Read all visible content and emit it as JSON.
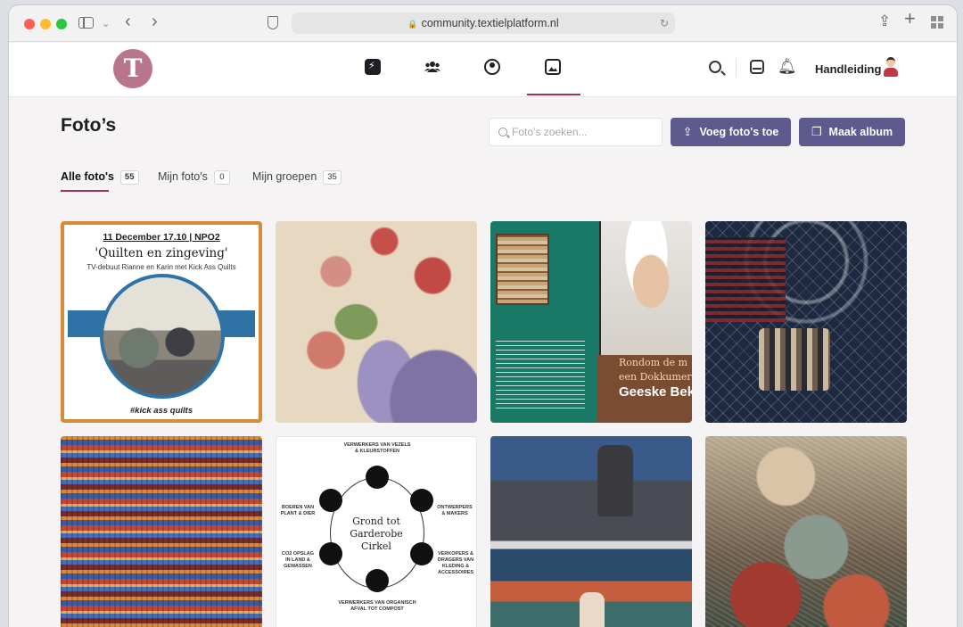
{
  "browser": {
    "url": "community.textielplatform.nl"
  },
  "header": {
    "logo_letter": "T",
    "nav_items": [
      {
        "icon": "activity-icon"
      },
      {
        "icon": "groups-icon"
      },
      {
        "icon": "profile-icon"
      },
      {
        "icon": "photos-icon",
        "active": true
      }
    ],
    "handleiding_label": "Handleiding"
  },
  "main": {
    "title": "Foto’s",
    "search_placeholder": "Foto’s zoeken...",
    "upload_button": "Voeg foto's toe",
    "album_button": "Maak album",
    "tabs": [
      {
        "label": "Alle foto's",
        "count": "55",
        "active": true
      },
      {
        "label": "Mijn foto's",
        "count": "0"
      },
      {
        "label": "Mijn groepen",
        "count": "35"
      }
    ]
  },
  "photos": {
    "quilt_poster": {
      "line1": "11 December 17.10 | NPO2",
      "line2": "'Quilten en zingeving'",
      "line3": "TV-debuut Rianne en Karin met Kick Ass Quilts",
      "hashtag": "#kick ass quilts"
    },
    "book_cover": {
      "line1": "Rondom de m",
      "line2": "een Dokkumer",
      "line3": "Geeske Bek"
    },
    "circle_diagram": {
      "center_line1": "Grond tot",
      "center_line2": "Garderobe",
      "center_line3": "Cirkel",
      "labels": [
        "VERWERKERS VAN VEZELS & KLEURSTOFFEN",
        "ONTWERPERS & MAKERS",
        "VERKOPERS & DRAGERS VAN KLEDING & ACCESSOIRES",
        "VERWERKERS VAN ORGANISCH AFVAL TOT COMPOST",
        "CO2 OPSLAG IN LAND & GEWASSEN",
        "BOEREN VAN PLANT & DIER"
      ]
    }
  }
}
